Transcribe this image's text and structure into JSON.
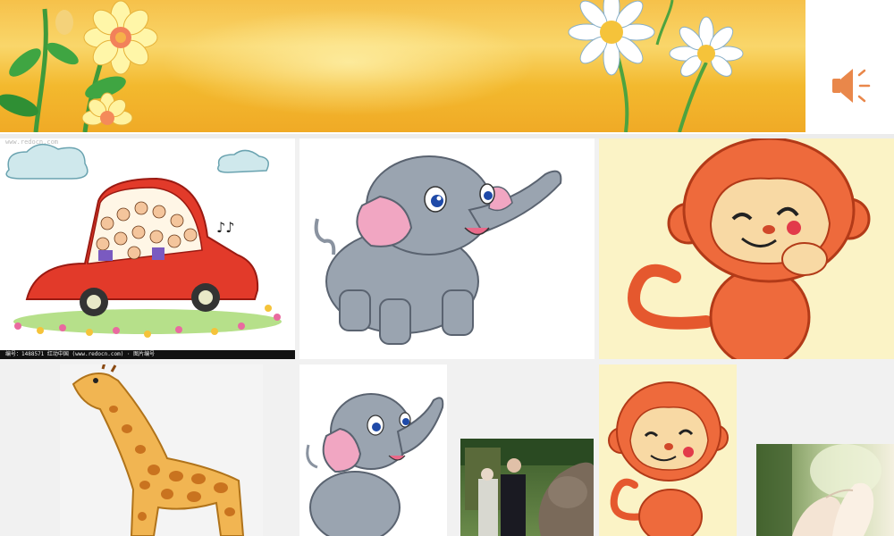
{
  "banner": {
    "image": "sunny-sky-with-flowers"
  },
  "audio": {
    "icon": "speaker-icon",
    "color": "#e9874a"
  },
  "tiles": [
    {
      "name": "car-with-people",
      "watermark": "www.redocn.com",
      "caption": "编号：1488571  红动中国 (www.redocn.com)  · 图片编号"
    },
    {
      "name": "elephant"
    },
    {
      "name": "monkey"
    },
    {
      "name": "giraffe"
    },
    {
      "name": "elephant-small"
    },
    {
      "name": "people-with-elephant-photo"
    },
    {
      "name": "monkey-small"
    },
    {
      "name": "hands-photo"
    }
  ]
}
